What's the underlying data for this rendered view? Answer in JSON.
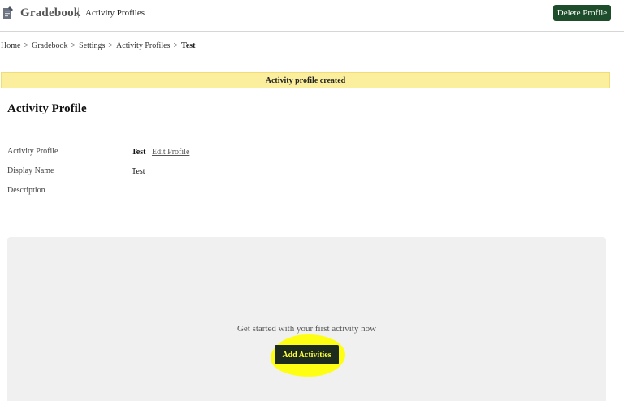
{
  "header": {
    "app_name": "Gradebook",
    "separator": "|",
    "section": "Activity Profiles",
    "logo_icon": "gradebook-document-icon",
    "delete_label": "Delete Profile",
    "delete_color": "#1d4d2b"
  },
  "breadcrumb": {
    "items": [
      "Home",
      "Gradebook",
      "Settings",
      "Activity Profiles"
    ],
    "separator": ">",
    "current": "Test"
  },
  "alert": {
    "message": "Activity profile created",
    "background": "#fbef9e"
  },
  "profile": {
    "title": "Activity Profile",
    "fields": [
      {
        "label": "Activity Profile",
        "value": "Test",
        "link": "Edit Profile"
      },
      {
        "label": "Display Name",
        "value": "Test"
      },
      {
        "label": "Description",
        "value": ""
      }
    ]
  },
  "empty_state": {
    "message": "Get started with your first activity now",
    "button_label": "Add Activities",
    "highlight_color": "#ffff00"
  }
}
